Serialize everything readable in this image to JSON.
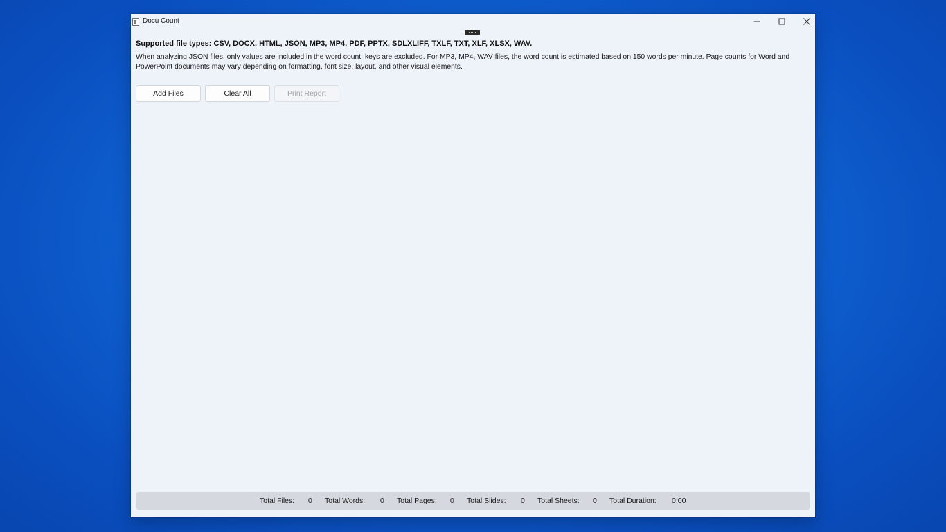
{
  "window": {
    "title": "Docu Count"
  },
  "info": {
    "supported_types": "Supported file types: CSV, DOCX, HTML, JSON, MP3, MP4, PDF, PPTX, SDLXLIFF, TXLF, TXT, XLF, XLSX, WAV.",
    "description": "When analyzing JSON files, only values are included in the word count; keys are excluded. For MP3, MP4, WAV files, the word count is estimated based on 150 words per minute. Page counts for Word and PowerPoint documents may vary depending on formatting, font size, layout, and other visual elements."
  },
  "toolbar": {
    "add_files": "Add Files",
    "clear_all": "Clear All",
    "print_report": "Print Report"
  },
  "stats": {
    "total_files_label": "Total Files:",
    "total_files_value": "0",
    "total_words_label": "Total Words:",
    "total_words_value": "0",
    "total_pages_label": "Total Pages:",
    "total_pages_value": "0",
    "total_slides_label": "Total Slides:",
    "total_slides_value": "0",
    "total_sheets_label": "Total Sheets:",
    "total_sheets_value": "0",
    "total_duration_label": "Total Duration:",
    "total_duration_value": "0:00"
  },
  "icons": {
    "app": "document-icon",
    "minimize": "minimize-icon",
    "maximize": "maximize-icon",
    "close": "close-icon"
  },
  "colors": {
    "desktop": "#0f62d2",
    "window_bg": "#eef2f9",
    "status_bar_bg": "#d5d9df"
  }
}
